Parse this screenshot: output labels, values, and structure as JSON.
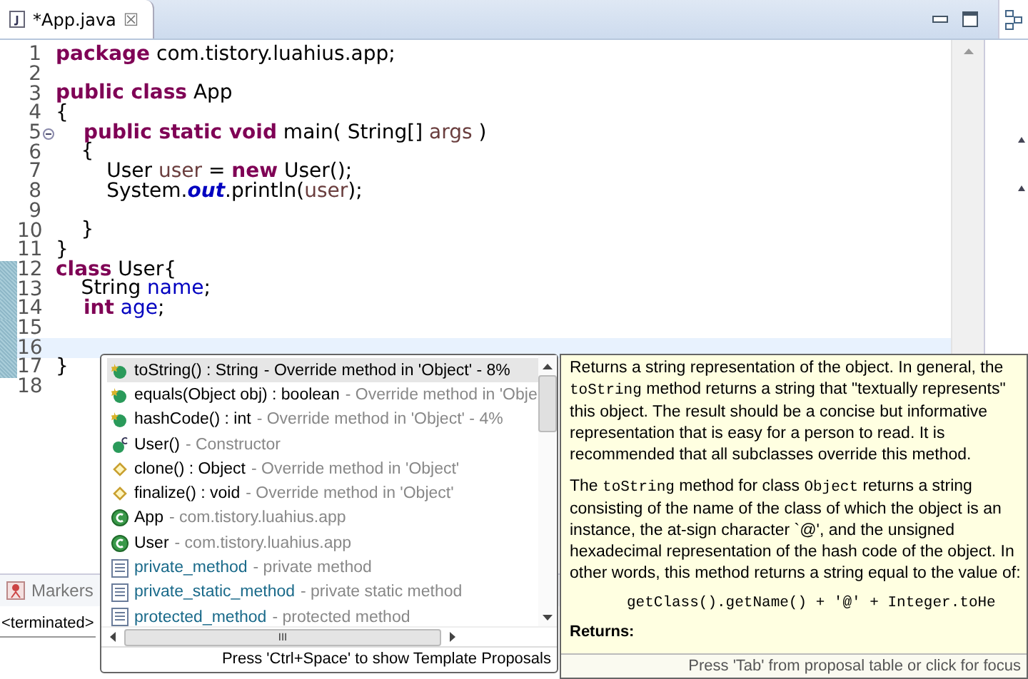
{
  "editor_tab": {
    "title": "*App.java",
    "close": "☒"
  },
  "code_lines": [
    {
      "number": "1",
      "changed": false,
      "current": false,
      "foldable": false,
      "tokens": [
        {
          "kind": "keyword",
          "text": "package"
        },
        {
          "kind": "plain",
          "text": " com.tistory.luahius.app;"
        }
      ]
    },
    {
      "number": "2",
      "changed": false,
      "current": false,
      "foldable": false
    },
    {
      "number": "3",
      "changed": false,
      "current": false,
      "foldable": false,
      "tokens": [
        {
          "kind": "keyword",
          "text": "public class"
        },
        {
          "kind": "plain",
          "text": " App"
        }
      ]
    },
    {
      "number": "4",
      "changed": false,
      "current": false,
      "foldable": false,
      "tokens": [
        {
          "kind": "plain",
          "text": "{"
        }
      ]
    },
    {
      "number": "5",
      "changed": false,
      "current": false,
      "foldable": true,
      "tokens": [
        {
          "kind": "keyword",
          "text": "    public static void"
        },
        {
          "kind": "plain",
          "text": " main( String[] "
        },
        {
          "kind": "variable",
          "text": "args"
        },
        {
          "kind": "plain",
          "text": " )"
        }
      ]
    },
    {
      "number": "6",
      "changed": false,
      "current": false,
      "foldable": false,
      "tokens": [
        {
          "kind": "plain",
          "text": "    {"
        }
      ]
    },
    {
      "number": "7",
      "changed": false,
      "current": false,
      "foldable": false,
      "tokens": [
        {
          "kind": "plain",
          "text": "        User "
        },
        {
          "kind": "variable",
          "text": "user"
        },
        {
          "kind": "plain",
          "text": " = "
        },
        {
          "kind": "keyword",
          "text": "new"
        },
        {
          "kind": "plain",
          "text": " User();"
        }
      ]
    },
    {
      "number": "8",
      "changed": false,
      "current": false,
      "foldable": false,
      "tokens": [
        {
          "kind": "plain",
          "text": "        System."
        },
        {
          "kind": "static",
          "text": "out"
        },
        {
          "kind": "plain",
          "text": ".println("
        },
        {
          "kind": "variable",
          "text": "user"
        },
        {
          "kind": "plain",
          "text": ");"
        }
      ]
    },
    {
      "number": "9",
      "changed": false,
      "current": false,
      "foldable": false
    },
    {
      "number": "10",
      "changed": false,
      "current": false,
      "foldable": false,
      "tokens": [
        {
          "kind": "plain",
          "text": "    }"
        }
      ]
    },
    {
      "number": "11",
      "changed": false,
      "current": false,
      "foldable": false,
      "tokens": [
        {
          "kind": "plain",
          "text": "}"
        }
      ]
    },
    {
      "number": "12",
      "changed": true,
      "current": false,
      "foldable": false,
      "tokens": [
        {
          "kind": "keyword",
          "text": "class"
        },
        {
          "kind": "plain",
          "text": " User{"
        }
      ]
    },
    {
      "number": "13",
      "changed": true,
      "current": false,
      "foldable": false,
      "tokens": [
        {
          "kind": "plain",
          "text": "    String "
        },
        {
          "kind": "field",
          "text": "name"
        },
        {
          "kind": "plain",
          "text": ";"
        }
      ]
    },
    {
      "number": "14",
      "changed": true,
      "current": false,
      "foldable": false,
      "tokens": [
        {
          "kind": "keyword",
          "text": "    int"
        },
        {
          "kind": "field",
          "text": " age"
        },
        {
          "kind": "plain",
          "text": ";"
        }
      ]
    },
    {
      "number": "15",
      "changed": true,
      "current": false,
      "foldable": false
    },
    {
      "number": "16",
      "changed": true,
      "current": true,
      "foldable": false
    },
    {
      "number": "17",
      "changed": true,
      "current": false,
      "foldable": false,
      "tokens": [
        {
          "kind": "plain",
          "text": "}"
        }
      ]
    },
    {
      "number": "18",
      "changed": false,
      "current": false,
      "foldable": false
    }
  ],
  "bottom_panel": {
    "tab": "Markers",
    "console_line": "<terminated>"
  },
  "proposals": {
    "items": [
      {
        "kind": "override",
        "name": "toString() : String",
        "detail": "- Override method in 'Object' - 8%",
        "selected": true
      },
      {
        "kind": "override",
        "name": "equals(Object obj) : boolean",
        "detail": "- Override method in 'Obje",
        "selected": false
      },
      {
        "kind": "override",
        "name": "hashCode() : int",
        "detail": "- Override method in 'Object' - 4%",
        "selected": false
      },
      {
        "kind": "constructor",
        "name": "User()",
        "detail": "- Constructor",
        "selected": false
      },
      {
        "kind": "protected",
        "name": "clone() : Object",
        "detail": "- Override method in 'Object'",
        "selected": false
      },
      {
        "kind": "protected",
        "name": "finalize() : void",
        "detail": "- Override method in 'Object'",
        "selected": false
      },
      {
        "kind": "class",
        "name": "App",
        "detail": "- com.tistory.luahius.app",
        "selected": false
      },
      {
        "kind": "class",
        "name": "User",
        "detail": "- com.tistory.luahius.app",
        "selected": false
      },
      {
        "kind": "template",
        "name": "private_method",
        "detail": "- private method",
        "selected": false
      },
      {
        "kind": "template",
        "name": "private_static_method",
        "detail": "- private static method",
        "selected": false
      },
      {
        "kind": "template",
        "name": "protected_method",
        "detail": "- protected method",
        "selected": false
      }
    ],
    "hscroll_grip": "III",
    "status": "Press 'Ctrl+Space' to show Template Proposals"
  },
  "doc": {
    "paragraphs": [
      [
        {
          "code": false,
          "text": "Returns a string representation of the object. In general, the "
        },
        {
          "code": true,
          "text": "toString"
        },
        {
          "code": false,
          "text": " method returns a string that \"textually represents\" this object. The result should be a concise but informative representation that is easy for a person to read. It is recommended that all subclasses override this method."
        }
      ],
      [
        {
          "code": false,
          "text": "The "
        },
        {
          "code": true,
          "text": "toString"
        },
        {
          "code": false,
          "text": " method for class "
        },
        {
          "code": true,
          "text": "Object"
        },
        {
          "code": false,
          "text": " returns a string consisting of the name of the class of which the object is an instance, the at-sign character `@', and the unsigned hexadecimal representation of the hash code of the object. In other words, this method returns a string equal to the value of:"
        }
      ]
    ],
    "code_sample": "getClass().getName() + '@' + Integer.toHe",
    "heading": "Returns:",
    "status": "Press 'Tab' from proposal table or click for focus"
  }
}
